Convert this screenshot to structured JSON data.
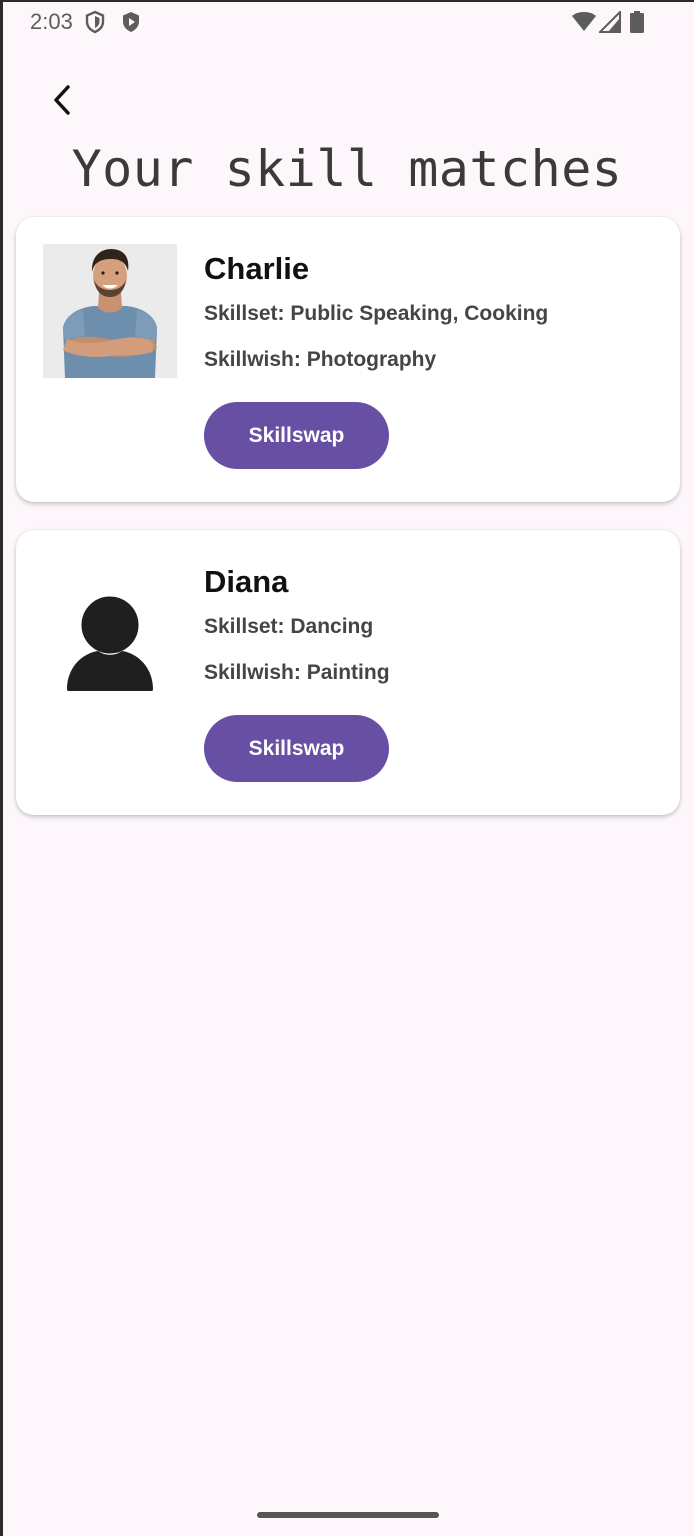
{
  "status_bar": {
    "time": "2:03",
    "icons": [
      "shield-icon",
      "play-shield-icon",
      "wifi-icon",
      "signal-icon",
      "battery-icon"
    ]
  },
  "header": {
    "back_icon": "chevron-left-icon",
    "title": "Your skill matches"
  },
  "matches": [
    {
      "name": "Charlie",
      "skillset": "Skillset: Public Speaking, Cooking",
      "skillwish": "Skillwish: Photography",
      "avatar": "profile-photo",
      "button_label": "Skillswap"
    },
    {
      "name": "Diana",
      "skillset": "Skillset: Dancing",
      "skillwish": "Skillwish: Painting",
      "avatar": "default-person-icon",
      "button_label": "Skillswap"
    }
  ],
  "colors": {
    "background": "#fdf7fc",
    "card": "#ffffff",
    "accent": "#6750a4",
    "title": "#3a3a3a"
  }
}
